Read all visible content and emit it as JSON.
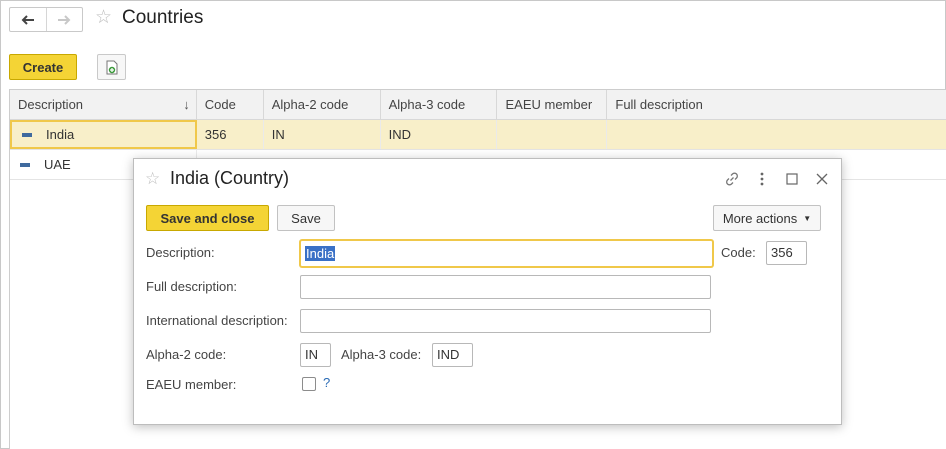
{
  "page": {
    "title": "Countries",
    "nav": {
      "back_icon": "arrow-left-icon",
      "forward_icon": "arrow-right-icon"
    },
    "create_label": "Create"
  },
  "table": {
    "columns": [
      "Description",
      "Code",
      "Alpha-2 code",
      "Alpha-3 code",
      "EAEU member",
      "Full description"
    ],
    "rows": [
      {
        "description": "India",
        "code": "356",
        "alpha2": "IN",
        "alpha3": "IND",
        "eaeu": "",
        "full": ""
      },
      {
        "description": "UAE",
        "code": "",
        "alpha2": "",
        "alpha3": "",
        "eaeu": "",
        "full": ""
      }
    ]
  },
  "dialog": {
    "title": "India (Country)",
    "save_close_label": "Save and close",
    "save_label": "Save",
    "more_actions_label": "More actions",
    "fields": {
      "description_label": "Description:",
      "description_value": "India",
      "code_label": "Code:",
      "code_value": "356",
      "full_description_label": "Full description:",
      "full_description_value": "",
      "international_description_label": "International description:",
      "international_description_value": "",
      "alpha2_label": "Alpha-2 code:",
      "alpha2_value": "IN",
      "alpha3_label": "Alpha-3 code:",
      "alpha3_value": "IND",
      "eaeu_label": "EAEU member:",
      "eaeu_checked": false,
      "help_label": "?"
    }
  }
}
